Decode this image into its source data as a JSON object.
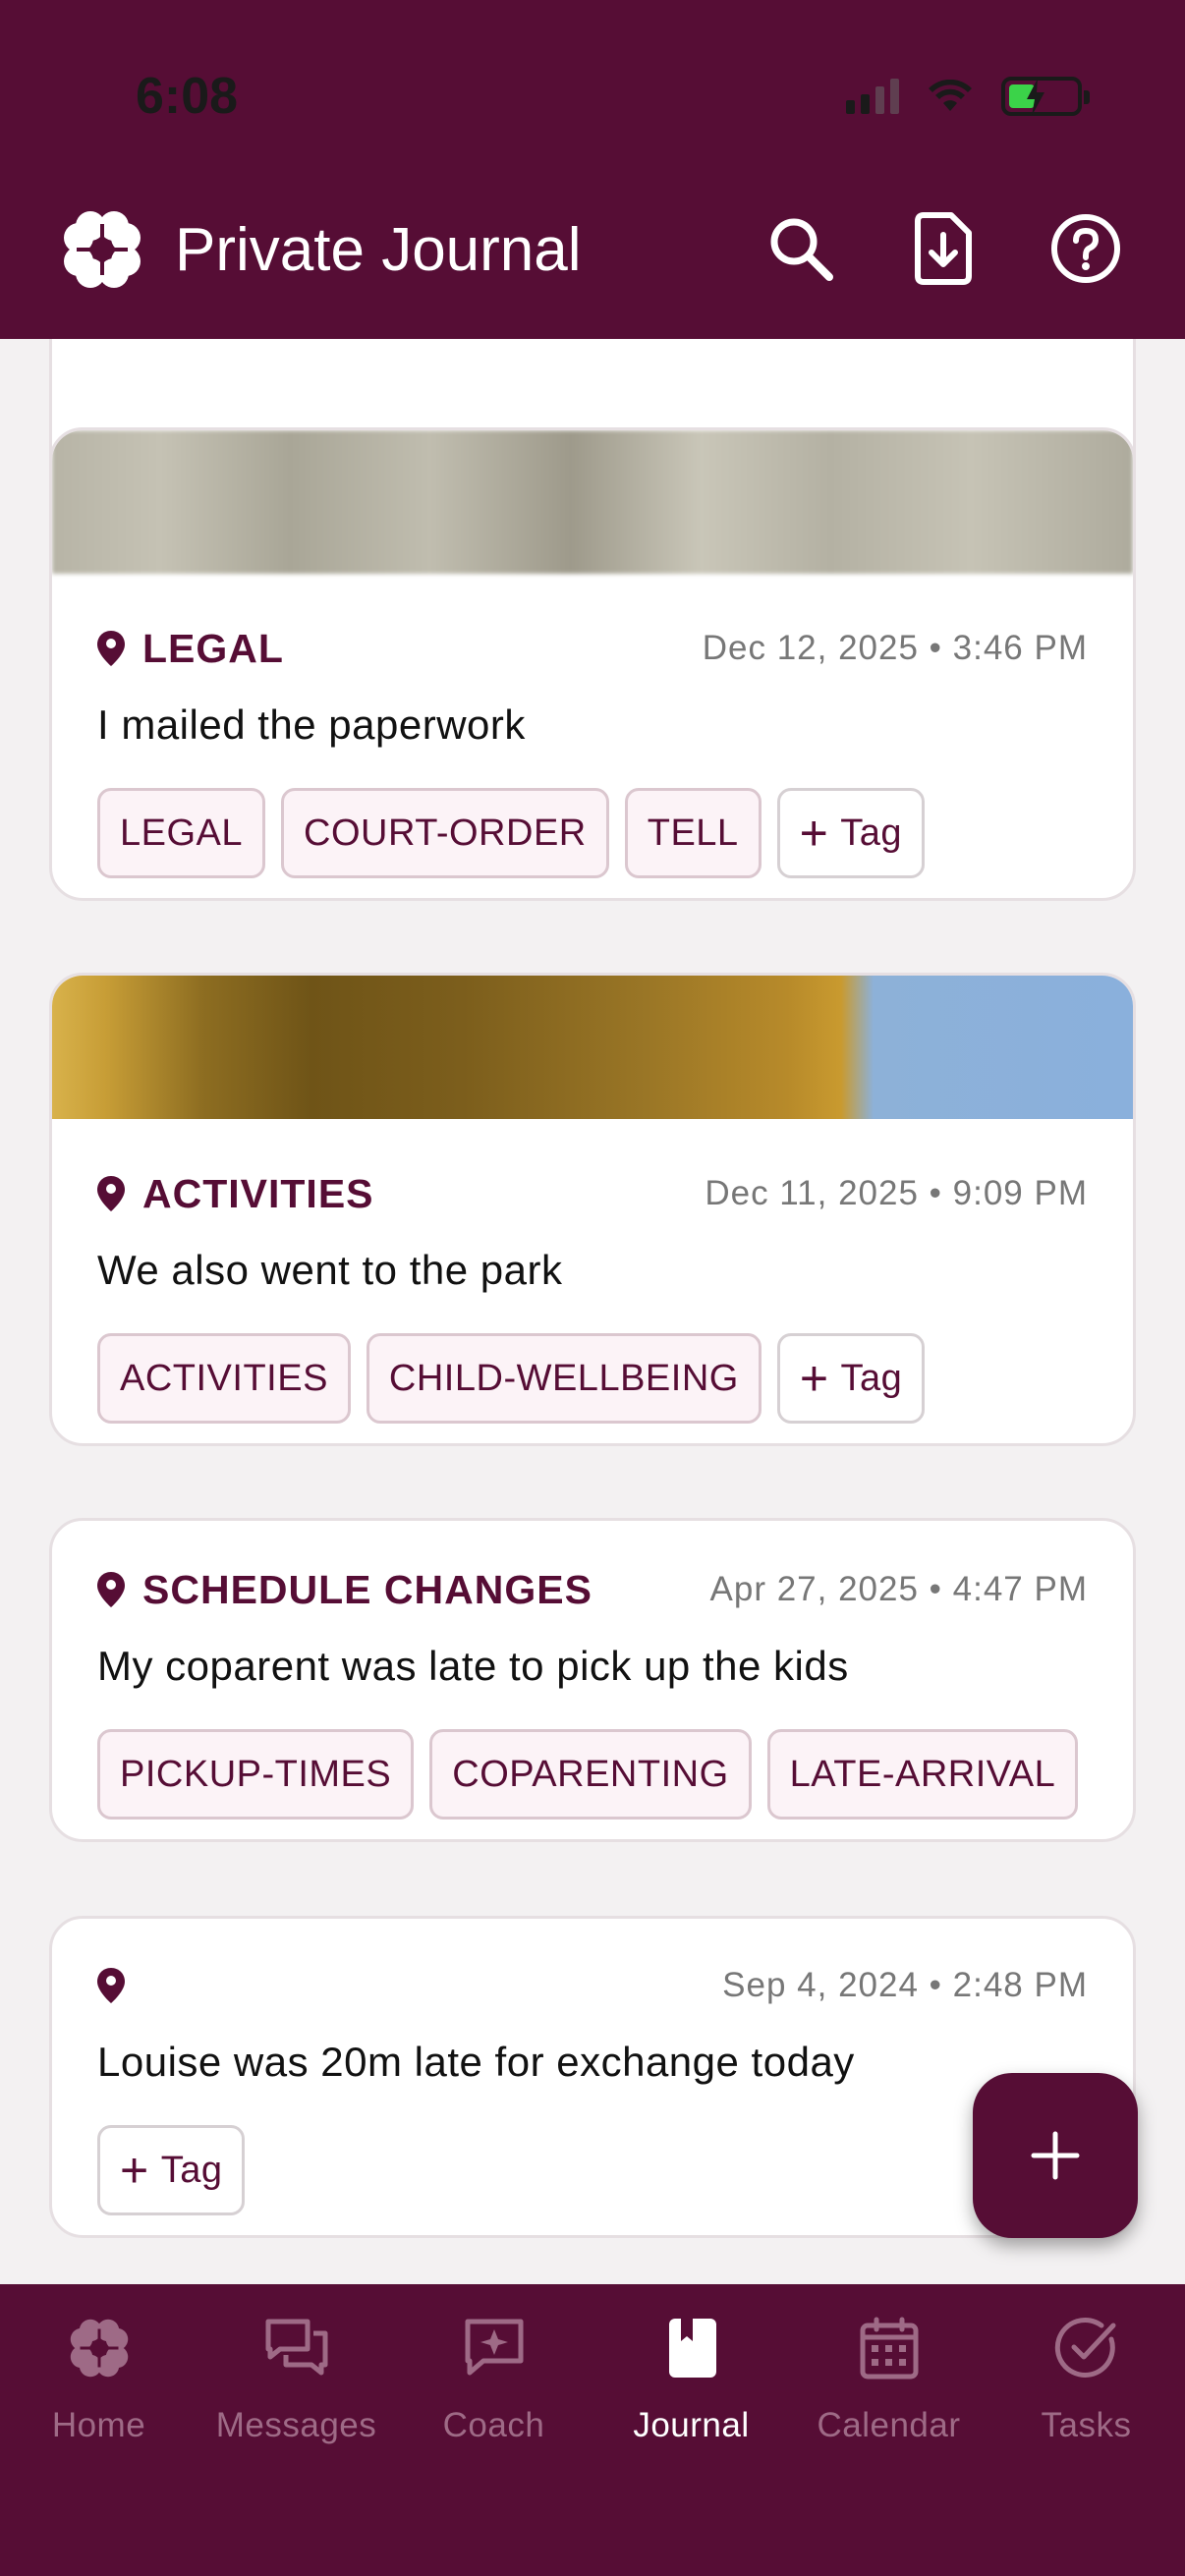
{
  "status_bar": {
    "time": "6:08"
  },
  "header": {
    "title": "Private Journal",
    "actions": [
      "search-icon",
      "export-icon",
      "help-icon"
    ]
  },
  "entries": [
    {
      "category": "LEGAL",
      "date": "Dec 12, 2025 • 3:46 PM",
      "text": "I mailed the paperwork",
      "tags": [
        "LEGAL",
        "COURT-ORDER",
        "TELL"
      ],
      "add_tag_label": "Tag"
    },
    {
      "category": "ACTIVITIES",
      "date": "Dec 11, 2025 • 9:09 PM",
      "text": "We also went to the park",
      "tags": [
        "ACTIVITIES",
        "CHILD-WELLBEING"
      ],
      "add_tag_label": "Tag"
    },
    {
      "category": "SCHEDULE CHANGES",
      "date": "Apr 27, 2025 • 4:47 PM",
      "text": "My coparent was late to pick up the kids",
      "tags": [
        "PICKUP-TIMES",
        "COPARENTING",
        "LATE-ARRIVAL"
      ]
    },
    {
      "category": "",
      "date": "Sep 4, 2024 • 2:48 PM",
      "text": "Louise was 20m late for exchange today",
      "tags": [],
      "add_tag_label": "Tag"
    }
  ],
  "fab": {
    "icon": "plus-icon"
  },
  "bottom_nav": [
    {
      "label": "Home",
      "icon": "clover-icon",
      "active": false
    },
    {
      "label": "Messages",
      "icon": "chat-icon",
      "active": false
    },
    {
      "label": "Coach",
      "icon": "sparkle-chat-icon",
      "active": false
    },
    {
      "label": "Journal",
      "icon": "journal-icon",
      "active": true
    },
    {
      "label": "Calendar",
      "icon": "calendar-icon",
      "active": false
    },
    {
      "label": "Tasks",
      "icon": "check-circle-icon",
      "active": false
    }
  ],
  "colors": {
    "brand": "#560d35",
    "tag_bg": "#fcf3f7",
    "nav_inactive": "#9e6a86"
  }
}
